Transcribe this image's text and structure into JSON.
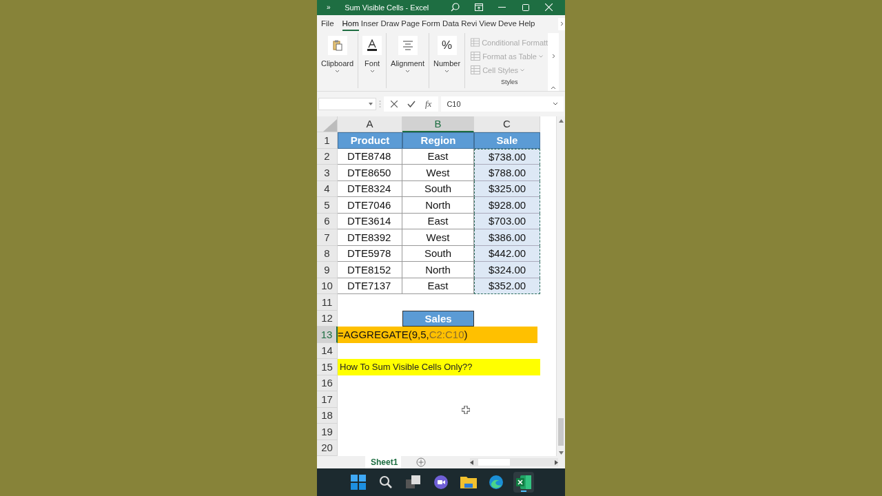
{
  "window": {
    "quick_access": "»",
    "title": "Sum Visible Cells  -  Excel"
  },
  "ribbon": {
    "tabs": [
      {
        "label": "File",
        "selected": false
      },
      {
        "label": "Hom",
        "selected": true
      },
      {
        "label": "Inser",
        "selected": false
      },
      {
        "label": "Draw",
        "selected": false
      },
      {
        "label": "Page",
        "selected": false
      },
      {
        "label": "Form",
        "selected": false
      },
      {
        "label": "Data",
        "selected": false
      },
      {
        "label": "Revi",
        "selected": false
      },
      {
        "label": "View",
        "selected": false
      },
      {
        "label": "Deve",
        "selected": false
      },
      {
        "label": "Help",
        "selected": false
      }
    ],
    "groups": [
      {
        "label": "Clipboard",
        "kind": "clipboard"
      },
      {
        "label": "Font",
        "kind": "font"
      },
      {
        "label": "Alignment",
        "kind": "alignment"
      },
      {
        "label": "Number",
        "kind": "number",
        "glyph": "%"
      }
    ],
    "styles": {
      "label": "Styles",
      "items": [
        {
          "label": "Conditional Formatt",
          "disabled": true,
          "dropdown": false
        },
        {
          "label": "Format as Table",
          "disabled": true,
          "dropdown": true
        },
        {
          "label": "Cell Styles",
          "disabled": true,
          "dropdown": true
        }
      ]
    }
  },
  "formula_bar": {
    "fx": "fx",
    "value": "C10"
  },
  "grid": {
    "columns": [
      {
        "label": "A",
        "selected": false,
        "copied": false
      },
      {
        "label": "B",
        "selected": true,
        "copied": false
      },
      {
        "label": "C",
        "selected": false,
        "copied": true
      }
    ],
    "rows": [
      {
        "number": "1",
        "selected": false,
        "kind": "header",
        "cells": [
          "Product",
          "Region",
          "Sale"
        ]
      },
      {
        "number": "2",
        "selected": false,
        "kind": "data",
        "cells": [
          "DTE8748",
          "East",
          "$738.00"
        ]
      },
      {
        "number": "3",
        "selected": false,
        "kind": "data",
        "cells": [
          "DTE8650",
          "West",
          "$788.00"
        ]
      },
      {
        "number": "4",
        "selected": false,
        "kind": "data",
        "cells": [
          "DTE8324",
          "South",
          "$325.00"
        ]
      },
      {
        "number": "5",
        "selected": false,
        "kind": "data",
        "cells": [
          "DTE7046",
          "North",
          "$928.00"
        ]
      },
      {
        "number": "6",
        "selected": false,
        "kind": "data",
        "cells": [
          "DTE3614",
          "East",
          "$703.00"
        ]
      },
      {
        "number": "7",
        "selected": false,
        "kind": "data",
        "cells": [
          "DTE8392",
          "West",
          "$386.00"
        ]
      },
      {
        "number": "8",
        "selected": false,
        "kind": "data",
        "cells": [
          "DTE5978",
          "South",
          "$442.00"
        ]
      },
      {
        "number": "9",
        "selected": false,
        "kind": "data",
        "cells": [
          "DTE8152",
          "North",
          "$324.00"
        ]
      },
      {
        "number": "10",
        "selected": false,
        "kind": "data",
        "cells": [
          "DTE7137",
          "East",
          "$352.00"
        ]
      },
      {
        "number": "11",
        "selected": false,
        "kind": "empty"
      },
      {
        "number": "12",
        "selected": false,
        "kind": "label",
        "text": "Sales"
      },
      {
        "number": "13",
        "selected": true,
        "kind": "formula",
        "parts": [
          {
            "text": "=AGGREGATE(9,5,",
            "kind": "plain"
          },
          {
            "text": "C2:C10",
            "kind": "reference"
          },
          {
            "text": ")",
            "kind": "plain"
          }
        ]
      },
      {
        "number": "14",
        "selected": false,
        "kind": "empty"
      },
      {
        "number": "15",
        "selected": false,
        "kind": "note",
        "text": "How To Sum Visible Cells Only??"
      },
      {
        "number": "16",
        "selected": false,
        "kind": "empty"
      },
      {
        "number": "17",
        "selected": false,
        "kind": "empty"
      },
      {
        "number": "18",
        "selected": false,
        "kind": "empty"
      },
      {
        "number": "19",
        "selected": false,
        "kind": "empty"
      },
      {
        "number": "20",
        "selected": false,
        "kind": "empty"
      }
    ]
  },
  "sheets": [
    {
      "label": "Sheet1",
      "selected": true
    }
  ],
  "taskbar": [
    {
      "kind": "start",
      "active": false
    },
    {
      "kind": "search",
      "active": false
    },
    {
      "kind": "taskview",
      "active": false
    },
    {
      "kind": "chat",
      "active": false
    },
    {
      "kind": "explorer",
      "active": false
    },
    {
      "kind": "edge",
      "active": false
    },
    {
      "kind": "excel",
      "active": true
    }
  ]
}
